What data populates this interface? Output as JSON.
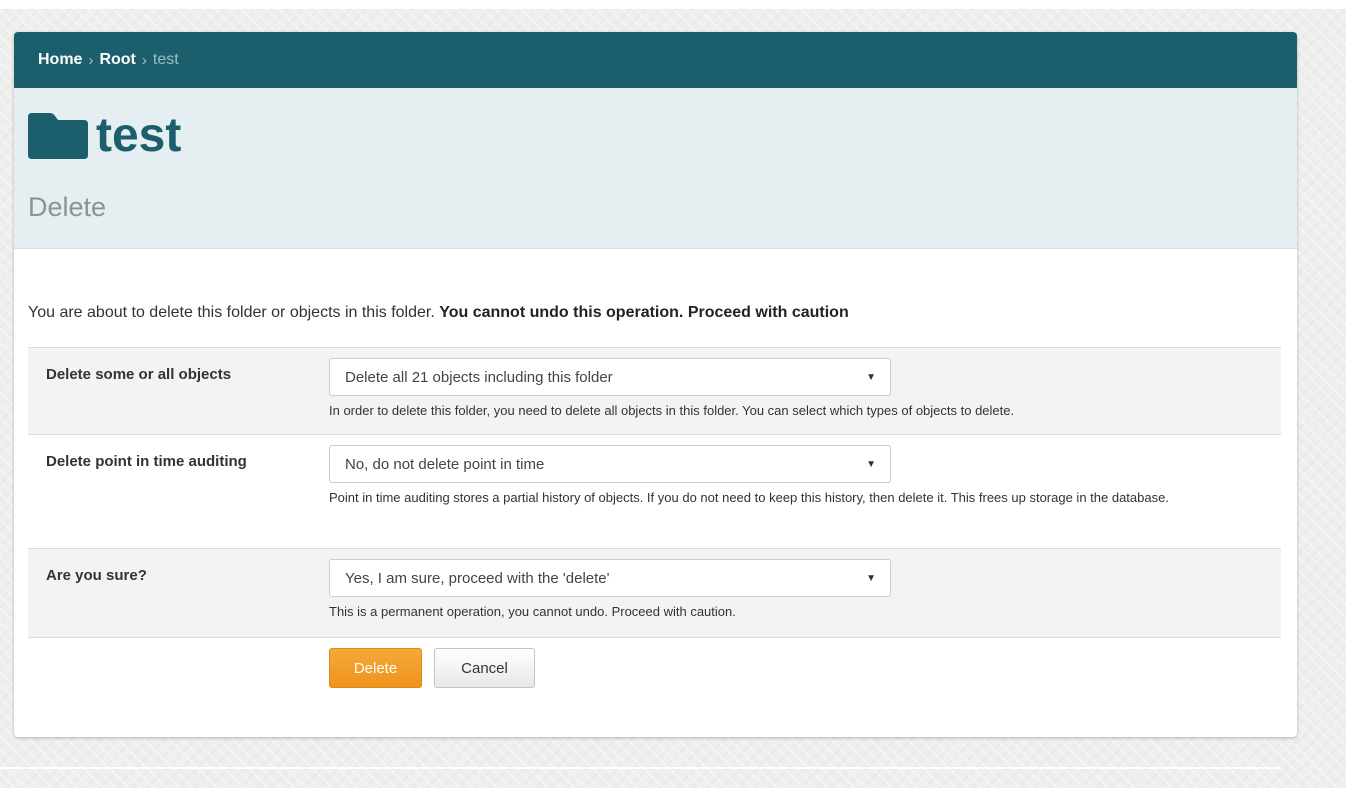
{
  "breadcrumb": {
    "items": [
      "Home",
      "Root",
      "test"
    ],
    "separator": "›"
  },
  "header": {
    "title": "test",
    "subtitle": "Delete",
    "icon": "folder-icon"
  },
  "warning": {
    "text": "You are about to delete this folder or objects in this folder. ",
    "strong": "You cannot undo this operation. Proceed with caution"
  },
  "form": {
    "rows": [
      {
        "label": "Delete some or all objects",
        "selected": "Delete all 21 objects including this folder",
        "help": "In order to delete this folder, you need to delete all objects in this folder. You can select which types of objects to delete."
      },
      {
        "label": "Delete point in time auditing",
        "selected": "No, do not delete point in time",
        "help": "Point in time auditing stores a partial history of objects. If you do not need to keep this history, then delete it. This frees up storage in the database."
      },
      {
        "label": "Are you sure?",
        "selected": "Yes, I am sure, proceed with the 'delete'",
        "help": "This is a permanent operation, you cannot undo. Proceed with caution."
      }
    ],
    "caret": "▼"
  },
  "buttons": {
    "delete_label": "Delete",
    "cancel_label": "Cancel"
  },
  "colors": {
    "accent": "#1b5f6d",
    "header_bg": "#e5eef1",
    "delete_button": "#f0931c"
  }
}
